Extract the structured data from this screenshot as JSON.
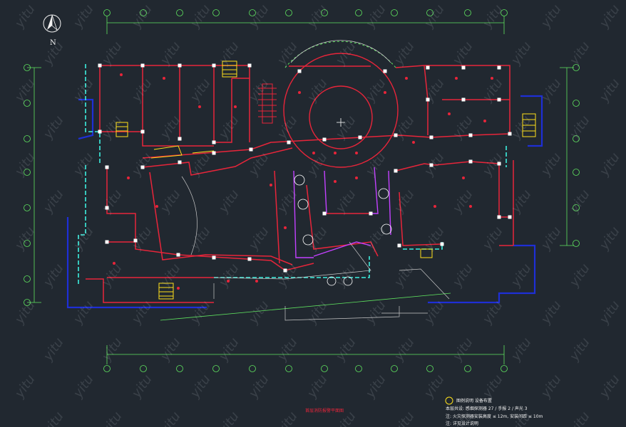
{
  "compass": {
    "north_label": "N"
  },
  "plan_title": "首层消防报警平面图",
  "legend": {
    "items": [
      "图例说明 设备布置",
      "本层共设: 感烟探测器 27 / 手报 2 / 声光 3",
      "注: 火灾探测器安装高度 ≤ 12m, 安装间距 ≤ 10m",
      "注: 详见设计说明"
    ]
  },
  "watermark": "yitu",
  "colors": {
    "background": "#212830",
    "grid": "#5fe35f",
    "wall": "#e8253a",
    "column": "#ffffff",
    "exterior": "#1e2fd6",
    "glazing": "#3df0e0",
    "interior": "#c8c8c8",
    "stair": "#ffe11a",
    "partition": "#c341ff"
  }
}
